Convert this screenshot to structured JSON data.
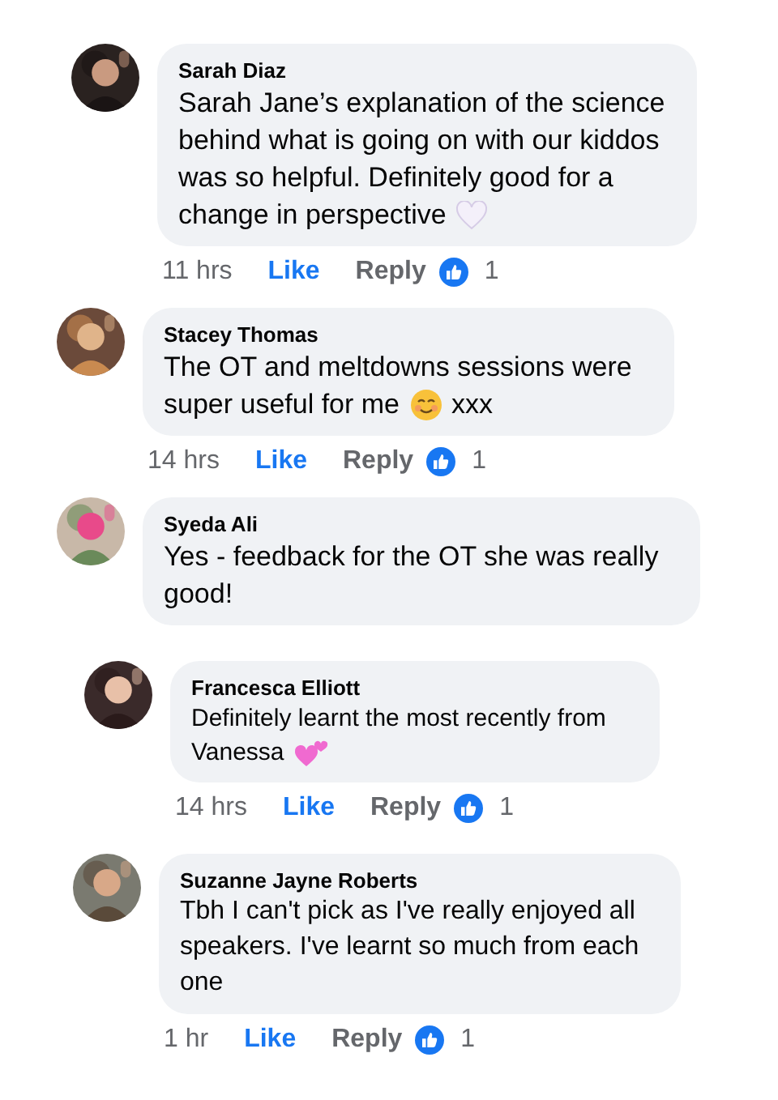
{
  "comments": [
    {
      "author": "Sarah Diaz",
      "text": "Sarah Jane’s explanation of the science behind what is going on with our kiddos was so helpful. Definitely good for a",
      "tail": "change in perspective",
      "kind": "heart",
      "actions": {
        "time": "11 hrs",
        "like": "Like",
        "reply": "Reply",
        "reactions": "1"
      }
    },
    {
      "author": "Stacey Thomas",
      "text": "The OT and meltdowns sessions were",
      "tail": "super useful for me",
      "kind": "smile",
      "trailing": "xxx",
      "actions": {
        "time": "14 hrs",
        "like": "Like",
        "reply": "Reply",
        "reactions": "1"
      }
    },
    {
      "author": "Syeda Ali",
      "text": "Yes - feedback for the OT she was really good!"
    },
    {
      "author": "Francesca Elliott",
      "text": "Definitely learnt the most recently from",
      "tail": "Vanessa",
      "kind": "hearts",
      "actions": {
        "time": "14 hrs",
        "like": "Like",
        "reply": "Reply",
        "reactions": "1"
      }
    },
    {
      "author": "Suzanne Jayne Roberts",
      "text": "Tbh I can't pick as I've really enjoyed all speakers. I've learnt so much from each one",
      "actions": {
        "time": "1 hr",
        "like": "Like",
        "reply": "Reply",
        "reactions": "1"
      }
    }
  ]
}
